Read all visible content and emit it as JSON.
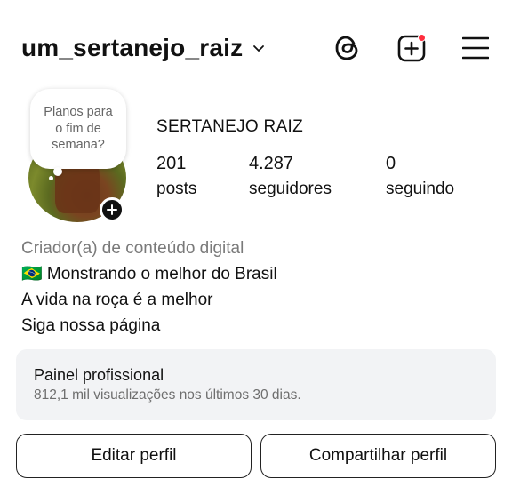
{
  "header": {
    "username": "um_sertanejo_raiz",
    "icons": [
      "chevron-down-icon",
      "threads-icon",
      "new-post-icon",
      "menu-icon"
    ],
    "notification_color": "#ff2d3d"
  },
  "profile": {
    "note": "Planos para o fim de semana?",
    "display_name": "SERTANEJO RAIZ",
    "stats": {
      "posts": {
        "value": "201",
        "label": "posts"
      },
      "followers": {
        "value": "4.287",
        "label": "seguidores"
      },
      "following": {
        "value": "0",
        "label": "seguindo"
      }
    }
  },
  "bio": {
    "category": "Criador(a) de conteúdo digital",
    "lines": [
      "🇧🇷 Monstrando o melhor do Brasil",
      "A vida na roça é a melhor",
      "Siga nossa página"
    ]
  },
  "professional_panel": {
    "title": "Painel profissional",
    "subtitle": "812,1 mil visualizações nos últimos 30 dias."
  },
  "buttons": {
    "edit": "Editar perfil",
    "share": "Compartilhar perfil"
  }
}
